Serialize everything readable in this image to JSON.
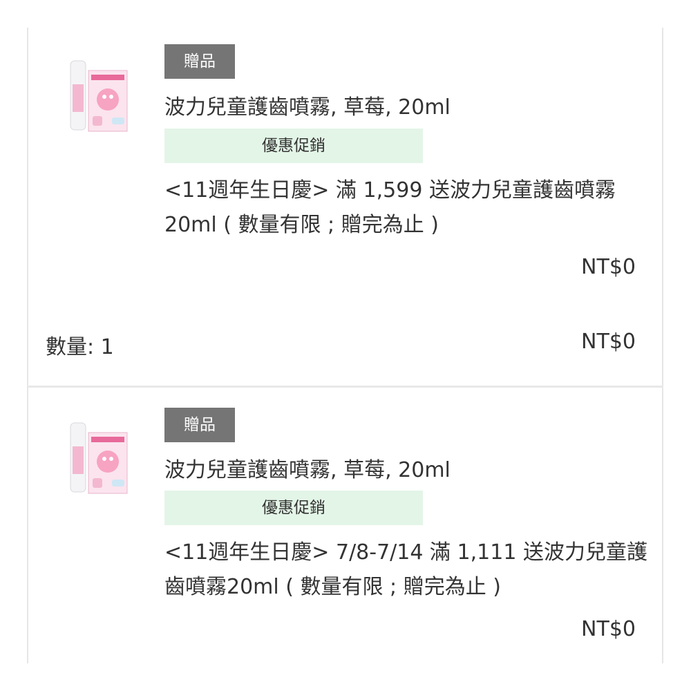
{
  "items": [
    {
      "badge": "贈品",
      "name": "波力兒童護齒噴霧, 草莓, 20ml",
      "promo_label": "優惠促銷",
      "promo_desc": "<11週年生日慶> 滿 1,599 送波力兒童護齒噴霧20ml ( 數量有限 ; 贈完為止 )",
      "unit_price": "NT$0",
      "quantity": "數量: 1",
      "subtotal": "NT$0"
    },
    {
      "badge": "贈品",
      "name": "波力兒童護齒噴霧, 草莓, 20ml",
      "promo_label": "優惠促銷",
      "promo_desc": "<11週年生日慶> 7/8-7/14 滿 1,111 送波力兒童護齒噴霧20ml ( 數量有限 ; 贈完為止 )",
      "unit_price": "NT$0"
    }
  ],
  "colors": {
    "badge_bg": "#757575",
    "promo_bg": "#e3f5e7",
    "border": "#e6e6e6",
    "text": "#333333"
  }
}
